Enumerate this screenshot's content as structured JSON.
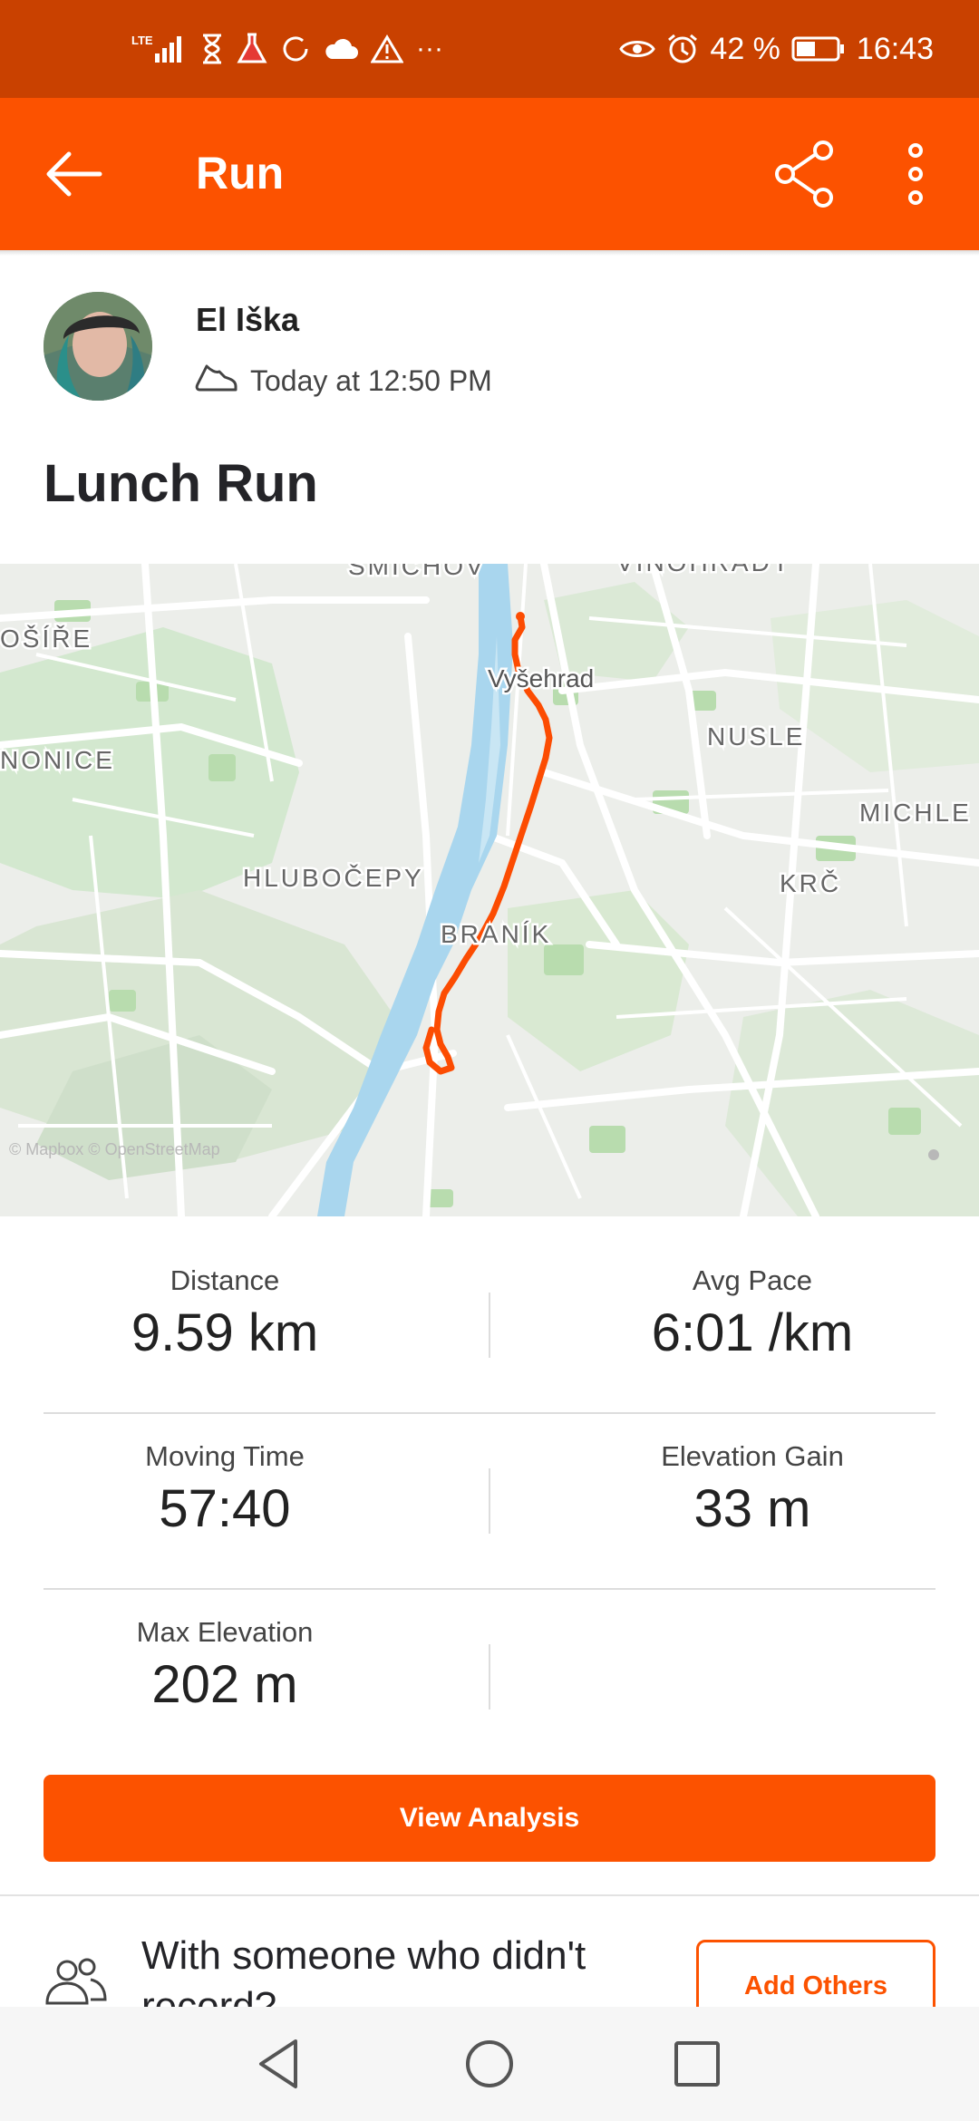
{
  "status_bar": {
    "network": "LTE",
    "battery": "42 %",
    "time": "16:43",
    "overflow": "···",
    "icons_left": [
      "signal-icon",
      "hourglass-icon",
      "flask-icon",
      "sync-icon",
      "cloud-icon",
      "warning-icon"
    ],
    "icons_right": [
      "eye-icon",
      "alarm-icon",
      "battery-icon"
    ]
  },
  "app_bar": {
    "title": "Run",
    "icons": [
      "back-arrow-icon",
      "share-icon",
      "more-vert-icon"
    ]
  },
  "activity": {
    "athlete_name": "El Iška",
    "timestamp": "Today at 12:50 PM",
    "title": "Lunch Run"
  },
  "map": {
    "labels": {
      "smichov": "SMÍCHOV",
      "vinohrady": "VINOHRADY",
      "osire": "OŠÍŘE",
      "vysehrad": "Vyšehrad",
      "nusle": "NUSLE",
      "nonice": "NONICE",
      "michle": "MICHLE",
      "hlubocepy": "HLUBOČEPY",
      "krc": "KRČ",
      "branik": "BRANÍK"
    },
    "attribution": "© Mapbox © OpenStreetMap",
    "route_color": "#fc4c02",
    "river_color": "#a9d6ee"
  },
  "stats": {
    "distance_label": "Distance",
    "distance_value": "9.59 km",
    "pace_label": "Avg Pace",
    "pace_value": "6:01 /km",
    "moving_label": "Moving Time",
    "moving_value": "57:40",
    "elev_gain_label": "Elevation Gain",
    "elev_gain_value": "33 m",
    "max_elev_label": "Max Elevation",
    "max_elev_value": "202 m"
  },
  "actions": {
    "analysis_label": "View Analysis",
    "others_text": "With someone who didn't record?",
    "add_others_label": "Add Others"
  },
  "nav_bar": {
    "icons": [
      "nav-back-icon",
      "nav-home-icon",
      "nav-recents-icon"
    ]
  },
  "colors": {
    "brand": "#fc5200",
    "status_bar": "#c94100"
  }
}
